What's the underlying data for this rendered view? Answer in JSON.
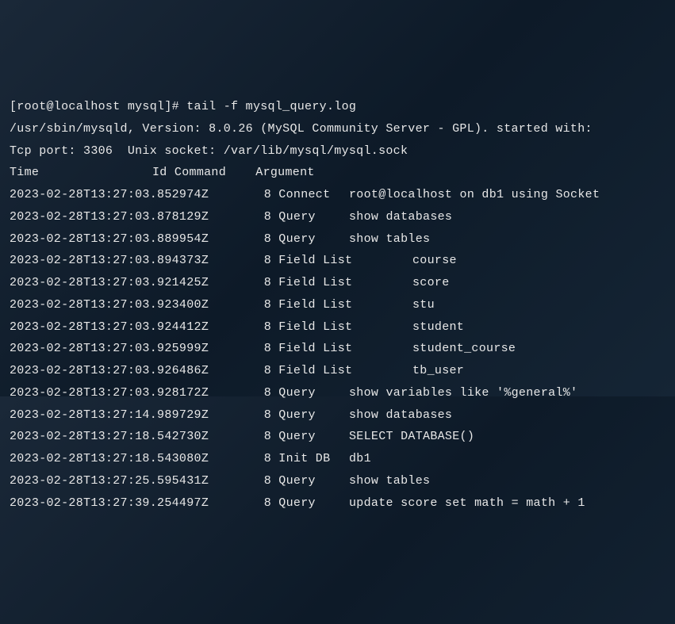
{
  "prompt_line": "[root@localhost mysql]# tail -f mysql_query.log",
  "startup_lines": [
    "/usr/sbin/mysqld, Version: 8.0.26 (MySQL Community Server - GPL). started with:",
    "Tcp port: 3306  Unix socket: /var/lib/mysql/mysql.sock"
  ],
  "header": {
    "time": "Time",
    "id": "Id",
    "command": "Command",
    "argument": "Argument"
  },
  "entries": [
    {
      "time": "2023-02-28T13:27:03.852974Z",
      "id": "8",
      "command": "Connect",
      "argument": "root@localhost on db1 using Socket"
    },
    {
      "time": "2023-02-28T13:27:03.878129Z",
      "id": "8",
      "command": "Query",
      "argument": "show databases"
    },
    {
      "time": "2023-02-28T13:27:03.889954Z",
      "id": "8",
      "command": "Query",
      "argument": "show tables"
    },
    {
      "time": "2023-02-28T13:27:03.894373Z",
      "id": "8",
      "command": "Field List",
      "argument": "course"
    },
    {
      "time": "2023-02-28T13:27:03.921425Z",
      "id": "8",
      "command": "Field List",
      "argument": "score"
    },
    {
      "time": "2023-02-28T13:27:03.923400Z",
      "id": "8",
      "command": "Field List",
      "argument": "stu"
    },
    {
      "time": "2023-02-28T13:27:03.924412Z",
      "id": "8",
      "command": "Field List",
      "argument": "student"
    },
    {
      "time": "2023-02-28T13:27:03.925999Z",
      "id": "8",
      "command": "Field List",
      "argument": "student_course"
    },
    {
      "time": "2023-02-28T13:27:03.926486Z",
      "id": "8",
      "command": "Field List",
      "argument": "tb_user"
    },
    {
      "time": "2023-02-28T13:27:03.928172Z",
      "id": "8",
      "command": "Query",
      "argument": "show variables like '%general%'"
    },
    {
      "time": "2023-02-28T13:27:14.989729Z",
      "id": "8",
      "command": "Query",
      "argument": "show databases"
    },
    {
      "time": "2023-02-28T13:27:18.542730Z",
      "id": "8",
      "command": "Query",
      "argument": "SELECT DATABASE()"
    },
    {
      "time": "2023-02-28T13:27:18.543080Z",
      "id": "8",
      "command": "Init DB",
      "argument": "db1"
    },
    {
      "time": "2023-02-28T13:27:25.595431Z",
      "id": "8",
      "command": "Query",
      "argument": "show tables"
    },
    {
      "time": "2023-02-28T13:27:39.254497Z",
      "id": "8",
      "command": "Query",
      "argument": "update score set math = math + 1"
    }
  ]
}
